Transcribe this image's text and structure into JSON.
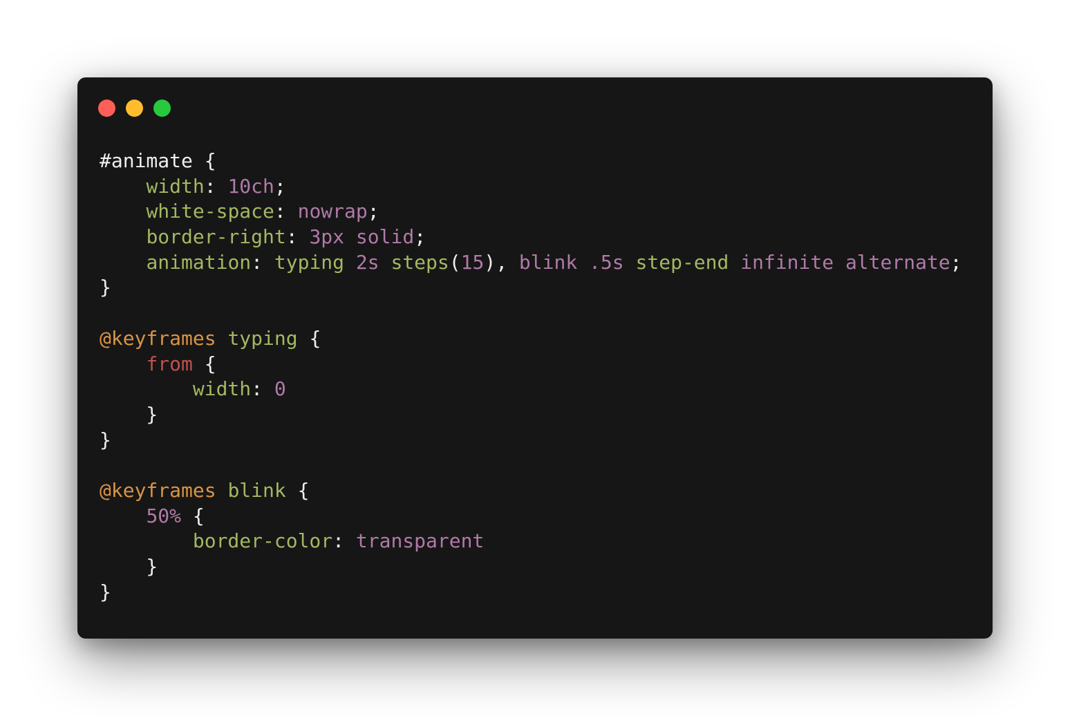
{
  "window": {
    "controls": [
      {
        "name": "close",
        "color": "#ff5f56"
      },
      {
        "name": "minimize",
        "color": "#ffbd2e"
      },
      {
        "name": "maximize",
        "color": "#27c93f"
      }
    ]
  },
  "colors": {
    "background": "#161616",
    "selector": "#eeeeee",
    "property": "#a3b862",
    "value": "#b07aa8",
    "at_rule": "#d99346",
    "from_keyword": "#c0504d"
  },
  "code": {
    "lines": [
      [
        {
          "t": "#animate",
          "k": "selector"
        },
        {
          "t": " {",
          "k": "punct"
        }
      ],
      [
        {
          "t": "    ",
          "k": "punct"
        },
        {
          "t": "width",
          "k": "prop"
        },
        {
          "t": ": ",
          "k": "punct"
        },
        {
          "t": "10ch",
          "k": "value"
        },
        {
          "t": ";",
          "k": "punct"
        }
      ],
      [
        {
          "t": "    ",
          "k": "punct"
        },
        {
          "t": "white-space",
          "k": "prop"
        },
        {
          "t": ": ",
          "k": "punct"
        },
        {
          "t": "nowrap",
          "k": "value"
        },
        {
          "t": ";",
          "k": "punct"
        }
      ],
      [
        {
          "t": "    ",
          "k": "punct"
        },
        {
          "t": "border-right",
          "k": "prop"
        },
        {
          "t": ": ",
          "k": "punct"
        },
        {
          "t": "3px",
          "k": "value"
        },
        {
          "t": " ",
          "k": "punct"
        },
        {
          "t": "solid",
          "k": "value"
        },
        {
          "t": ";",
          "k": "punct"
        }
      ],
      [
        {
          "t": "    ",
          "k": "punct"
        },
        {
          "t": "animation",
          "k": "prop"
        },
        {
          "t": ": ",
          "k": "punct"
        },
        {
          "t": "typing",
          "k": "func"
        },
        {
          "t": " ",
          "k": "punct"
        },
        {
          "t": "2s",
          "k": "value"
        },
        {
          "t": " ",
          "k": "punct"
        },
        {
          "t": "steps",
          "k": "func"
        },
        {
          "t": "(",
          "k": "punct"
        },
        {
          "t": "15",
          "k": "value"
        },
        {
          "t": "), ",
          "k": "punct"
        },
        {
          "t": "blink",
          "k": "value"
        },
        {
          "t": " ",
          "k": "punct"
        },
        {
          "t": ".5s",
          "k": "value"
        },
        {
          "t": " ",
          "k": "punct"
        },
        {
          "t": "step-end",
          "k": "func"
        },
        {
          "t": " ",
          "k": "punct"
        },
        {
          "t": "infinite",
          "k": "value"
        },
        {
          "t": " ",
          "k": "punct"
        },
        {
          "t": "alternate",
          "k": "value"
        },
        {
          "t": ";",
          "k": "punct"
        }
      ],
      [
        {
          "t": "}",
          "k": "punct"
        }
      ],
      [],
      [
        {
          "t": "@keyframes",
          "k": "at"
        },
        {
          "t": " ",
          "k": "punct"
        },
        {
          "t": "typing",
          "k": "name"
        },
        {
          "t": " {",
          "k": "punct"
        }
      ],
      [
        {
          "t": "    ",
          "k": "punct"
        },
        {
          "t": "from",
          "k": "from"
        },
        {
          "t": " {",
          "k": "punct"
        }
      ],
      [
        {
          "t": "        ",
          "k": "punct"
        },
        {
          "t": "width",
          "k": "prop"
        },
        {
          "t": ": ",
          "k": "punct"
        },
        {
          "t": "0",
          "k": "value"
        }
      ],
      [
        {
          "t": "    }",
          "k": "punct"
        }
      ],
      [
        {
          "t": "}",
          "k": "punct"
        }
      ],
      [],
      [
        {
          "t": "@keyframes",
          "k": "at"
        },
        {
          "t": " ",
          "k": "punct"
        },
        {
          "t": "blink",
          "k": "name"
        },
        {
          "t": " {",
          "k": "punct"
        }
      ],
      [
        {
          "t": "    ",
          "k": "punct"
        },
        {
          "t": "50%",
          "k": "value"
        },
        {
          "t": " {",
          "k": "punct"
        }
      ],
      [
        {
          "t": "        ",
          "k": "punct"
        },
        {
          "t": "border-color",
          "k": "prop"
        },
        {
          "t": ": ",
          "k": "punct"
        },
        {
          "t": "transparent",
          "k": "value"
        }
      ],
      [
        {
          "t": "    }",
          "k": "punct"
        }
      ],
      [
        {
          "t": "}",
          "k": "punct"
        }
      ]
    ]
  }
}
